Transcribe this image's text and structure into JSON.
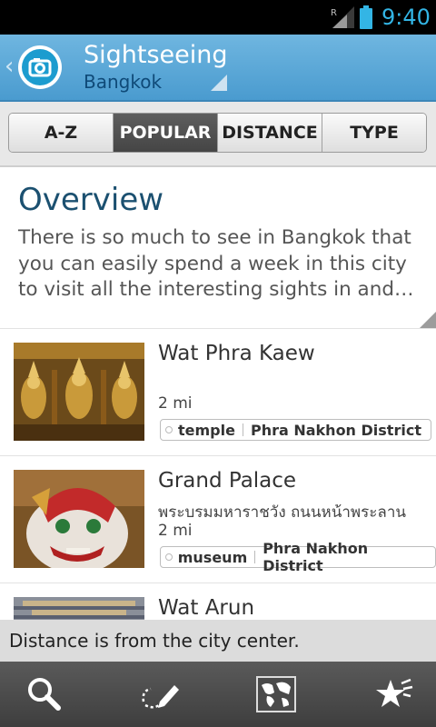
{
  "status_bar": {
    "time": "9:40",
    "roaming": "R"
  },
  "header": {
    "title": "Sightseeing",
    "subtitle": "Bangkok"
  },
  "tabs": [
    {
      "label": "A-Z"
    },
    {
      "label": "POPULAR",
      "active": true
    },
    {
      "label": "DISTANCE"
    },
    {
      "label": "TYPE"
    }
  ],
  "overview": {
    "title": "Overview",
    "text": "There is so much to see in Bangkok that you can easily spend a week in this city to visit all the interesting sights in and…"
  },
  "items": [
    {
      "title": "Wat Phra Kaew",
      "subtitle": "",
      "distance": "2 mi",
      "tag": "temple",
      "district": "Phra Nakhon District"
    },
    {
      "title": "Grand Palace",
      "subtitle": "พระบรมมหาราชวัง ถนนหน้าพระลาน",
      "distance": "2 mi",
      "tag": "museum",
      "district": "Phra Nakhon District"
    },
    {
      "title": "Wat Arun"
    }
  ],
  "toast": {
    "text": "Distance is from the city center."
  },
  "bottom_bar": {
    "icons": [
      "search-icon",
      "route-icon",
      "map-icon",
      "favorites-icon"
    ]
  },
  "colors": {
    "accent": "#33b5e5",
    "header": "#5aa7d6",
    "title": "#1b5070"
  }
}
